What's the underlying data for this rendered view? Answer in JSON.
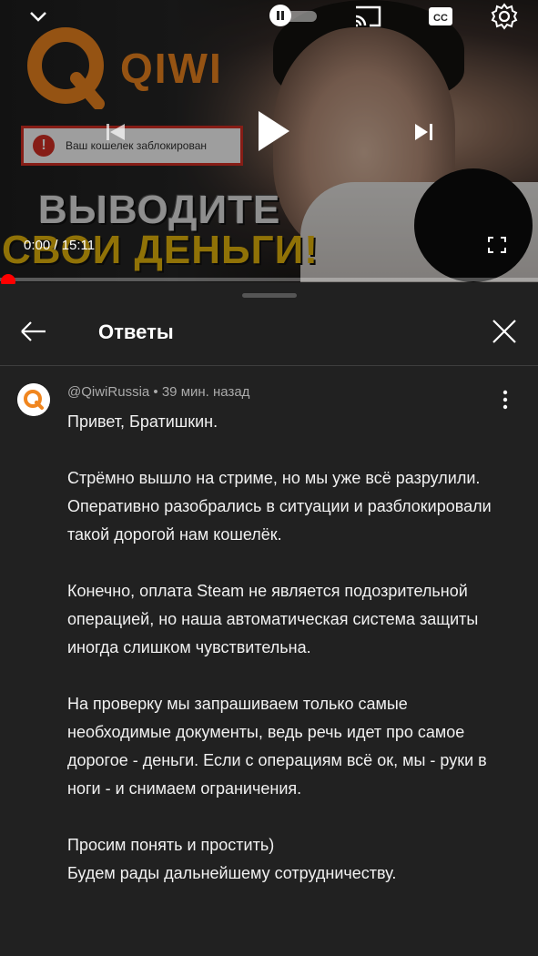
{
  "video": {
    "brand_text": "QIWI",
    "blocked_message": "Ваш кошелек заблокирован",
    "headline_line1": "ВЫВОДИТЕ",
    "headline_line2": "СВОИ ДЕНЬГИ!",
    "time_display": "0:00 / 15:11",
    "progress_fraction": 0.0
  },
  "colors": {
    "accent_red": "#ff0000",
    "qiwi_orange": "#f0861f",
    "sheet_bg": "#212121"
  },
  "header": {
    "title": "Ответы"
  },
  "comment": {
    "author": "@QiwiRussia",
    "separator": " • ",
    "time_ago": "39 мин. назад",
    "text": "Привет, Братишкин.\n\nСтрёмно вышло на стриме, но мы уже всё разрулили.\nОперативно разобрались в ситуации и разблокировали такой дорогой нам кошелёк.\n\nКонечно, оплата Steam не является подозрительной операцией, но наша автоматическая система защиты иногда слишком чувствительна.\n\nНа проверку мы запрашиваем только самые необходимые документы, ведь речь идет про самое дорогое - деньги. Если с операциям всё ок, мы - руки в ноги - и снимаем ограничения.\n\nПросим понять и простить)\nБудем рады дальнейшему сотрудничеству."
  },
  "icons": {
    "minimize": "chevron-down-icon",
    "autoplay": "autoplay-toggle-icon",
    "cast": "cast-icon",
    "captions": "captions-icon",
    "settings": "gear-icon",
    "previous": "skip-previous-icon",
    "play": "play-icon",
    "next": "skip-next-icon",
    "fullscreen": "fullscreen-icon",
    "back": "back-arrow-icon",
    "close": "close-icon",
    "more": "more-vert-icon"
  }
}
